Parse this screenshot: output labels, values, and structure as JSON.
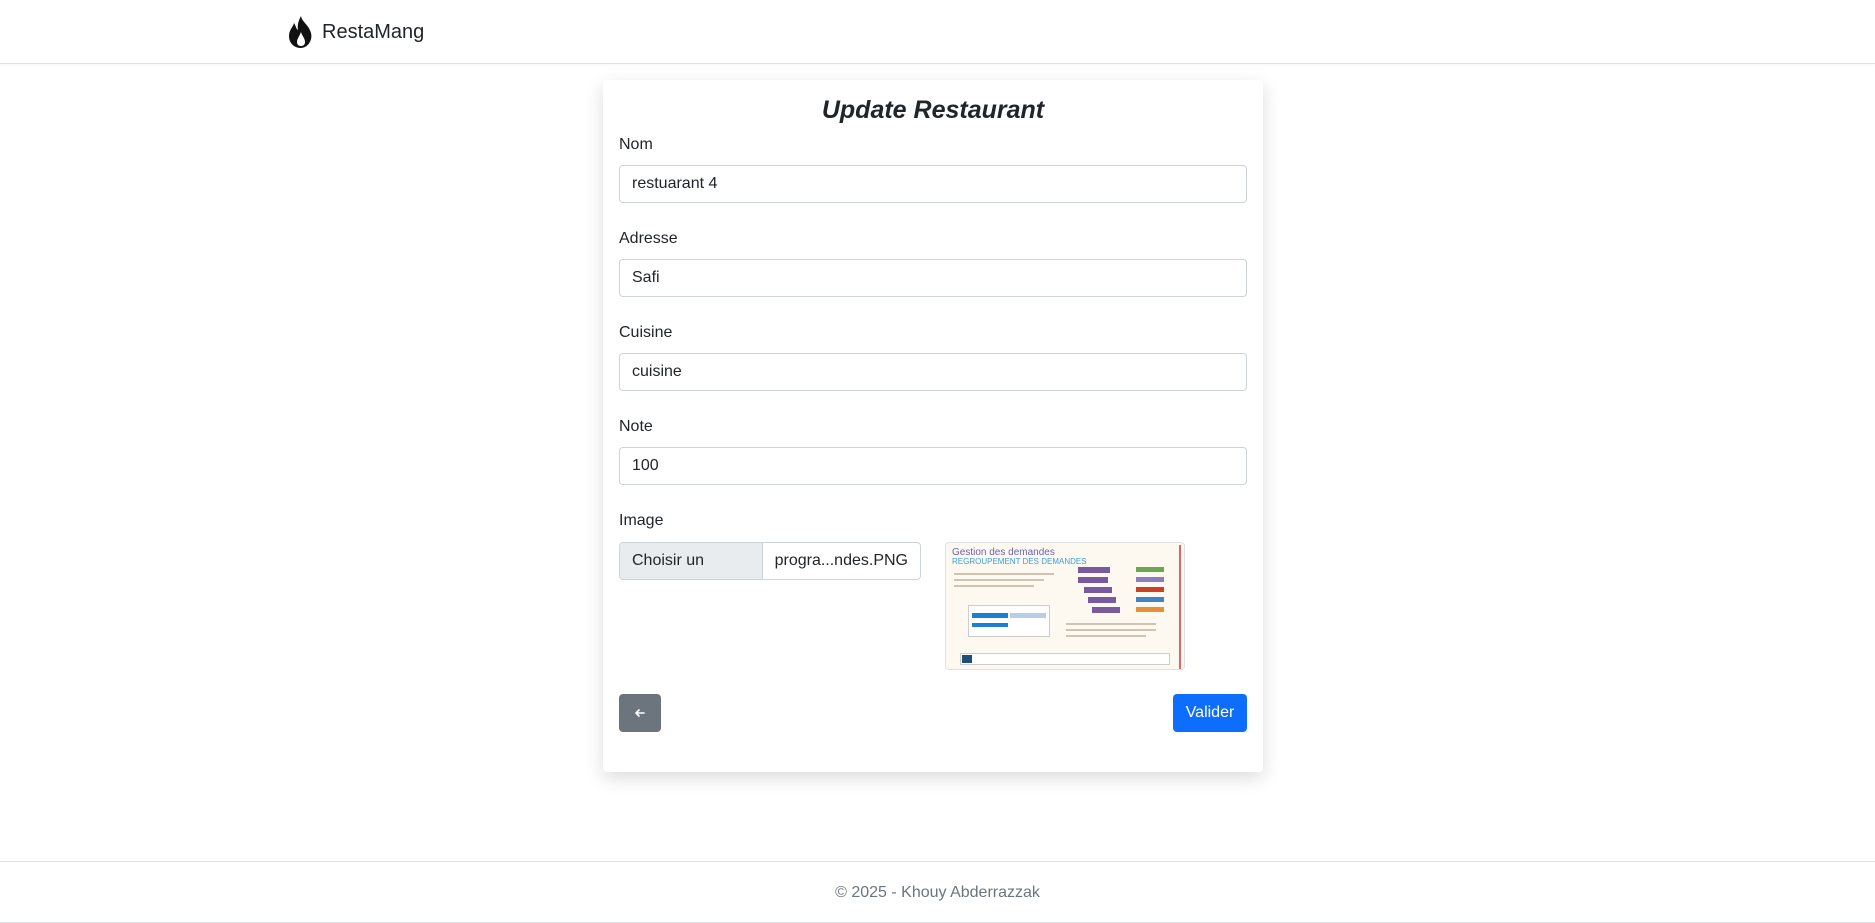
{
  "navbar": {
    "brand_icon": "flame-icon",
    "brand_name": "RestaMang"
  },
  "form": {
    "title": "Update Restaurant",
    "fields": {
      "nom": {
        "label": "Nom",
        "value": "restuarant 4"
      },
      "adresse": {
        "label": "Adresse",
        "value": "Safi"
      },
      "cuisine": {
        "label": "Cuisine",
        "value": "cuisine"
      },
      "note": {
        "label": "Note",
        "value": "100"
      }
    },
    "image": {
      "label": "Image",
      "button_label": "Choisir un fichier",
      "file_name": "progra...ndes.PNG",
      "preview": {
        "title": "Gestion des demandes",
        "subtitle": "REGROUPEMENT DES DEMANDES"
      }
    },
    "back_icon": "arrow-left-icon",
    "submit_label": "Valider"
  },
  "footer": {
    "text": "© 2025 - Khouy Abderrazzak"
  },
  "colors": {
    "primary": "#0d6efd",
    "secondary": "#6c757d",
    "border": "#ced4da"
  }
}
